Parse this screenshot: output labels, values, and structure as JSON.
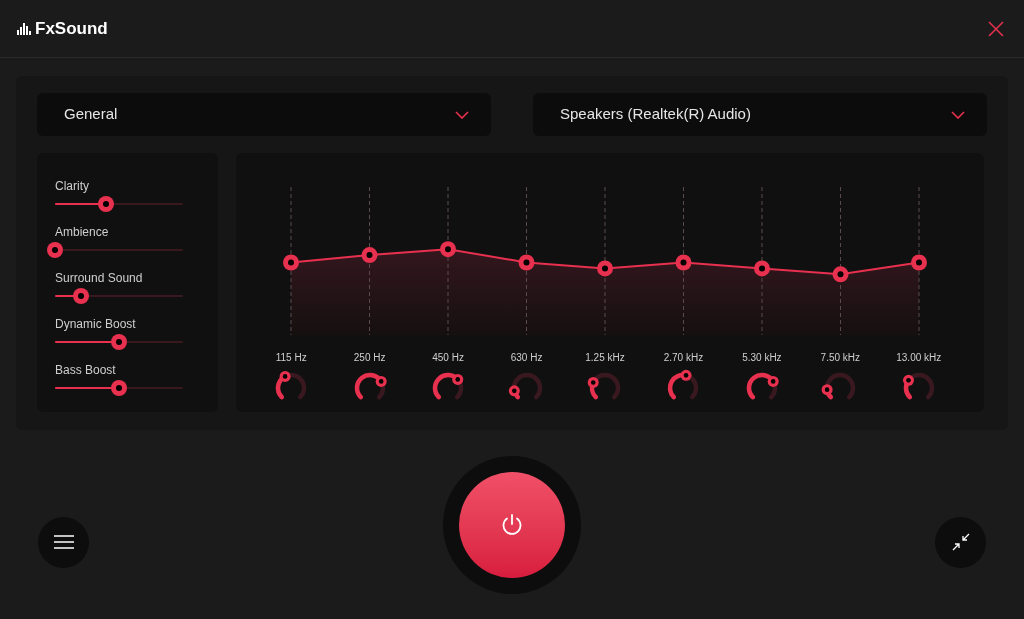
{
  "app": {
    "title": "FxSound"
  },
  "preset": {
    "value": "General"
  },
  "output": {
    "value": "Speakers (Realtek(R) Audio)"
  },
  "effects": [
    {
      "label": "Clarity",
      "level": 0.4
    },
    {
      "label": "Ambience",
      "level": 0
    },
    {
      "label": "Surround Sound",
      "level": 0.2
    },
    {
      "label": "Dynamic Boost",
      "level": 0.5
    },
    {
      "label": "Bass Boost",
      "level": 0.5
    }
  ],
  "bands": [
    {
      "label": "115 Hz",
      "level": 0.49
    },
    {
      "label": "250 Hz",
      "level": 0.54
    },
    {
      "label": "450 Hz",
      "level": 0.58
    },
    {
      "label": "630 Hz",
      "level": 0.49
    },
    {
      "label": "1.25 kHz",
      "level": 0.45
    },
    {
      "label": "2.70 kHz",
      "level": 0.49
    },
    {
      "label": "5.30 kHz",
      "level": 0.45
    },
    {
      "label": "7.50 kHz",
      "level": 0.41
    },
    {
      "label": "13.00 kHz",
      "level": 0.49
    }
  ],
  "power": {
    "on": true
  }
}
